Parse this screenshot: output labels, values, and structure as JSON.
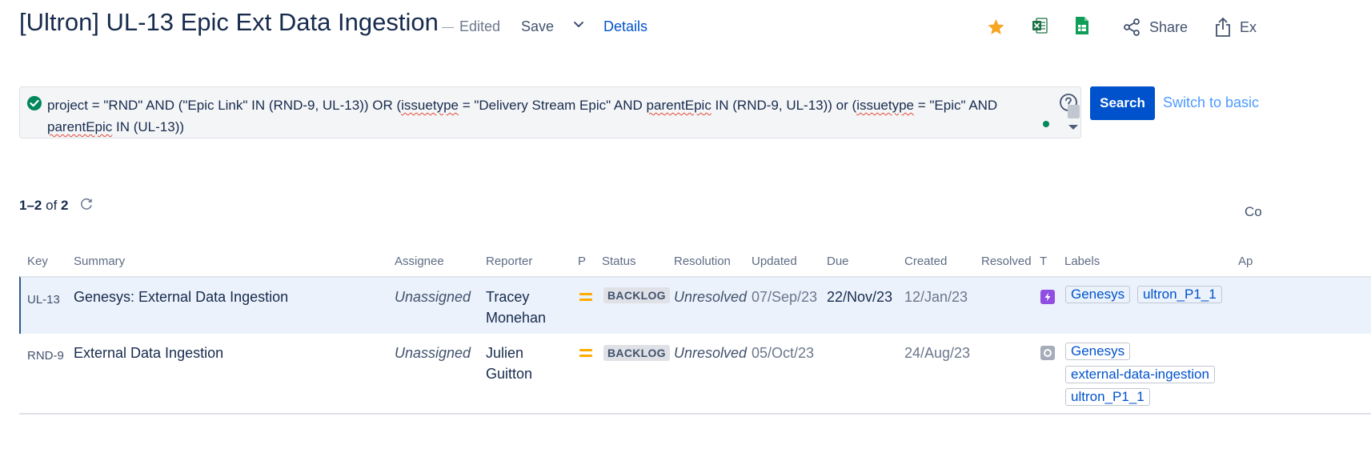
{
  "header": {
    "title": "[Ultron] UL-13 Epic Ext Data Ingestion",
    "edited": "Edited",
    "save_label": "Save",
    "details_label": "Details",
    "share_label": "Share",
    "export_label": "Ex",
    "icons": [
      "star-icon",
      "excel-icon",
      "google-sheets-icon",
      "share-icon",
      "export-icon"
    ],
    "colors": {
      "star": "#f5a623",
      "excel": "#1d7245",
      "sheets": "#0f9d58"
    }
  },
  "query": {
    "parts": {
      "p1": "project = \"RND\" AND (\"Epic Link\" IN (RND-9, UL-13)) OR (",
      "w1": "issuetype",
      "p2": " = \"Delivery Stream Epic\" AND ",
      "w2": "parentEpic",
      "p3": " IN (RND-9, UL-13)) or (",
      "w3": "issuetype",
      "p4": " = \"Epic\" AND\n",
      "w4": "parentEpic",
      "p5": " IN (UL-13))"
    },
    "search_label": "Search",
    "switch_label": "Switch to basic"
  },
  "results": {
    "range": "1–2",
    "of": "of",
    "total": "2",
    "columns_cut": "Co"
  },
  "table": {
    "headers": {
      "key": "Key",
      "summary": "Summary",
      "assignee": "Assignee",
      "reporter": "Reporter",
      "p": "P",
      "status": "Status",
      "resolution": "Resolution",
      "updated": "Updated",
      "due": "Due",
      "created": "Created",
      "resolved": "Resolved",
      "t": "T",
      "labels": "Labels",
      "ap": "Ap"
    },
    "rows": [
      {
        "key": "UL-13",
        "summary": "Genesys: External Data Ingestion",
        "assignee": "Unassigned",
        "reporter_1": "Tracey",
        "reporter_2": "Monehan",
        "priority": "medium",
        "status": "BACKLOG",
        "resolution": "Unresolved",
        "updated": "07/Sep/23",
        "due": "22/Nov/23",
        "created": "12/Jan/23",
        "resolved": "",
        "type": "epic",
        "labels": [
          "Genesys",
          "ultron_P1_1"
        ]
      },
      {
        "key": "RND-9",
        "summary": "External Data Ingestion",
        "assignee": "Unassigned",
        "reporter_1": "Julien",
        "reporter_2": "Guitton",
        "priority": "medium",
        "status": "BACKLOG",
        "resolution": "Unresolved",
        "updated": "05/Oct/23",
        "due": "",
        "created": "24/Aug/23",
        "resolved": "",
        "type": "other",
        "labels": [
          "Genesys",
          "external-data-ingestion",
          "ultron_P1_1"
        ]
      }
    ]
  }
}
